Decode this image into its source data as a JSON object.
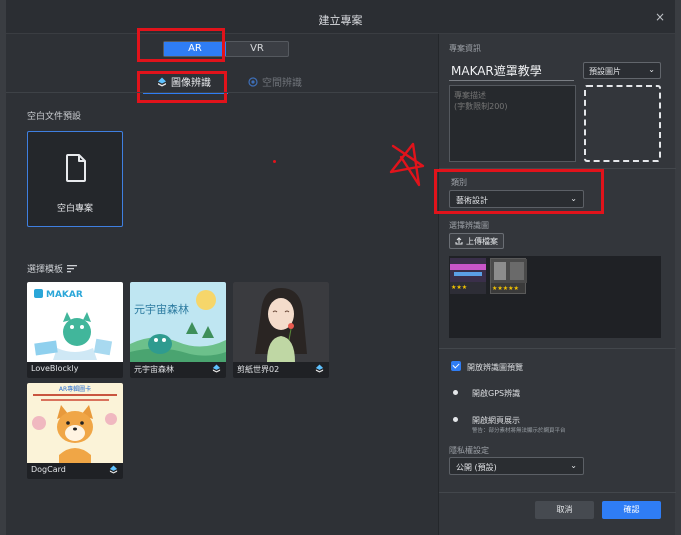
{
  "dialog": {
    "title": "建立專案",
    "close_label": "×"
  },
  "mode_toggle": {
    "ar_label": "AR",
    "vr_label": "VR",
    "active": "AR"
  },
  "tabs": [
    {
      "label": "圖像辨識",
      "active": true
    },
    {
      "label": "空間辨識",
      "active": false
    }
  ],
  "blank_section": {
    "label": "空白文件預設",
    "card_label": "空白專案"
  },
  "templates_section": {
    "label": "選擇模板",
    "items": [
      {
        "name": "LoveBlockly",
        "thumb_text": "MAKAR"
      },
      {
        "name": "元宇宙森林",
        "thumb_text": "元宇宙森林"
      },
      {
        "name": "剪紙世界02",
        "thumb_text": ""
      },
      {
        "name": "DogCard",
        "thumb_text": "AR專輯圖卡"
      }
    ]
  },
  "project_info": {
    "label": "專案資訊",
    "name_value": "MAKAR遮罩教學",
    "image_select_value": "預設圖片",
    "description_placeholder": "專案描述\n(字數限制200)"
  },
  "category": {
    "label": "類別",
    "value": "藝術設計"
  },
  "recognition": {
    "label": "選擇辨識圖",
    "upload_label": "上傳檔案",
    "markers": [
      {
        "stars": "★★★"
      },
      {
        "stars": "★★★★★"
      }
    ]
  },
  "options": {
    "preview_label": "開放辨識圖預覽",
    "preview_checked": true,
    "gps_label": "開啟GPS辨識",
    "web_label": "開啟網頁展示",
    "web_warning": "警告：部分素材將無法顯示於網頁平台"
  },
  "privacy": {
    "label": "隱私權設定",
    "value": "公開 (預設)"
  },
  "actions": {
    "cancel_label": "取消",
    "confirm_label": "確認"
  },
  "colors": {
    "accent": "#2f7df5",
    "annotation_red": "#e1131b",
    "panel_bg": "#2e3136"
  }
}
